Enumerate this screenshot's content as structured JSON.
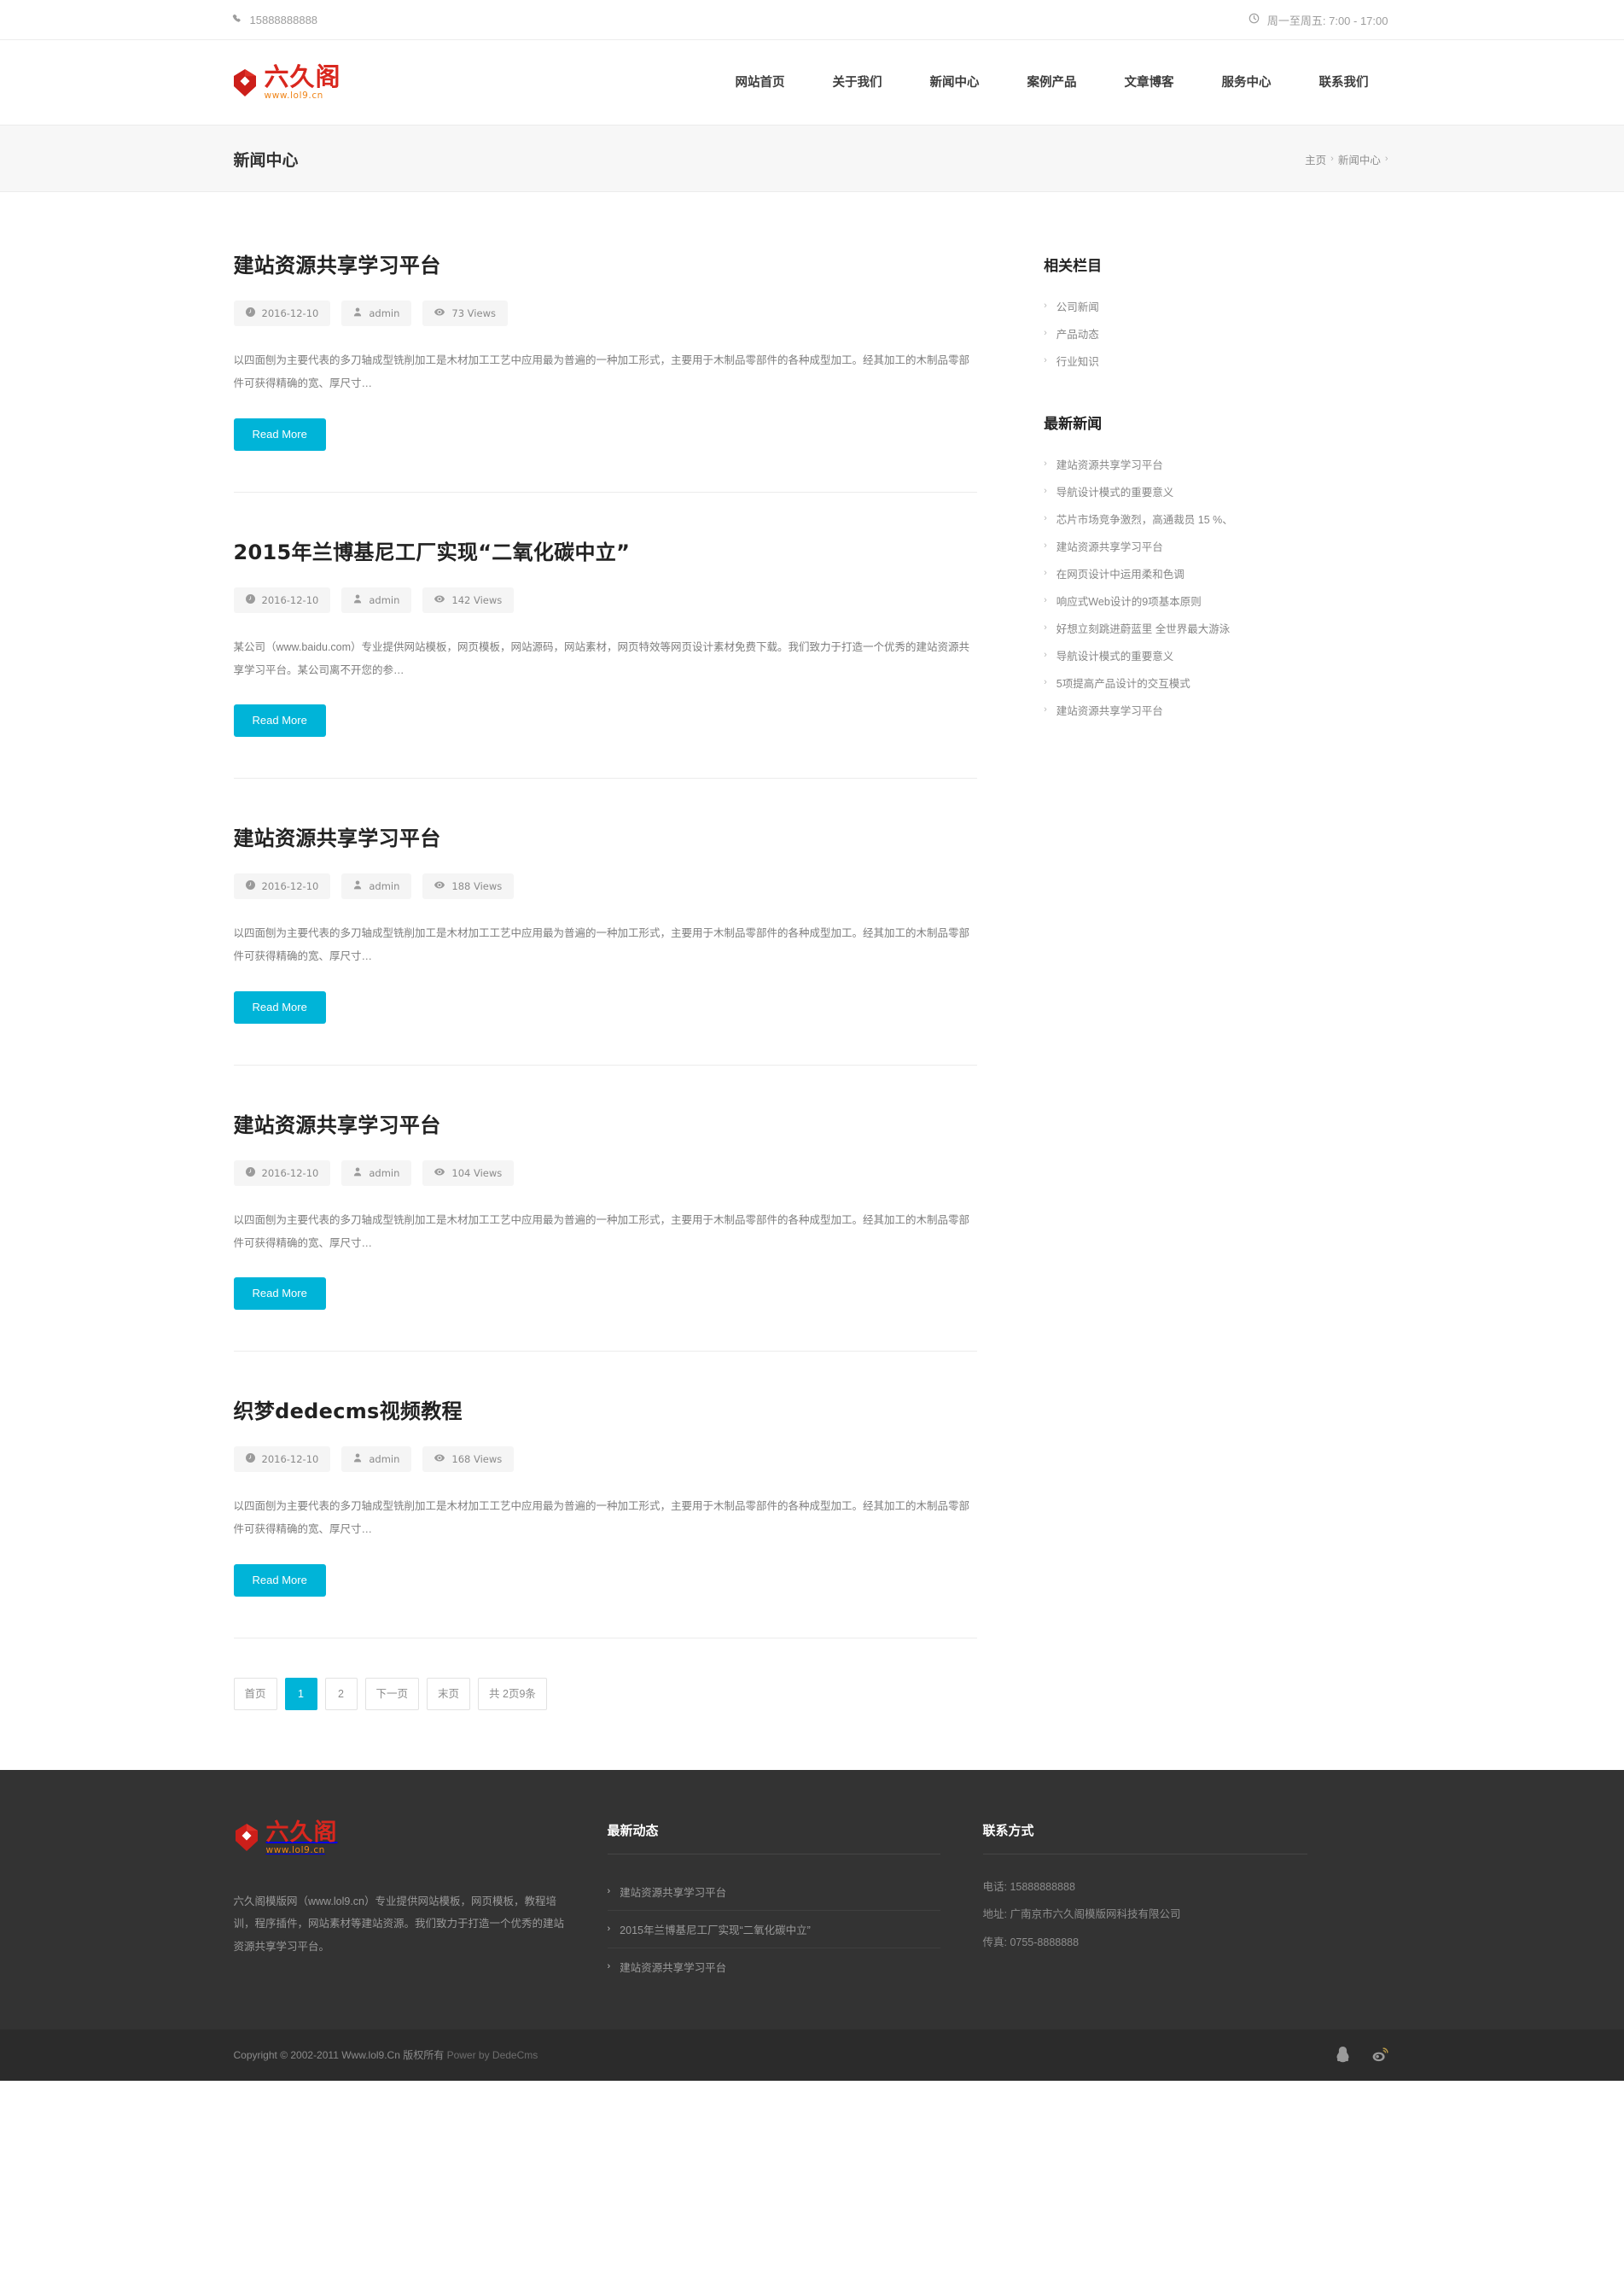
{
  "topbar": {
    "phone": "15888888888",
    "phone_icon": "phone-icon",
    "hours": "周一至周五: 7:00 - 17:00",
    "hours_icon": "clock-icon"
  },
  "brand": {
    "name_cn": "六久阁",
    "url_text": "www.lol9.cn",
    "mark_color": "#cc1f1a",
    "text_color": "#d9271e",
    "url_color": "#f08519"
  },
  "nav": {
    "items": [
      {
        "label": "网站首页",
        "active": false
      },
      {
        "label": "关于我们",
        "active": false
      },
      {
        "label": "新闻中心",
        "active": true
      },
      {
        "label": "案例产品",
        "active": false
      },
      {
        "label": "文章博客",
        "active": false
      },
      {
        "label": "服务中心",
        "active": false
      },
      {
        "label": "联系我们",
        "active": false
      }
    ]
  },
  "banner": {
    "title": "新闻中心",
    "breadcrumb": {
      "home": "主页",
      "current": "新闻中心",
      "separator": "›"
    }
  },
  "articles": [
    {
      "title": "建站资源共享学习平台",
      "date": "2016-12-10",
      "author": "admin",
      "views": "73 Views",
      "excerpt": "以四面刨为主要代表的多刀轴成型铣削加工是木材加工工艺中应用最为普遍的一种加工形式，主要用于木制品零部件的各种成型加工。经其加工的木制品零部件可获得精确的宽、厚尺寸…",
      "button": "Read More"
    },
    {
      "title": "2015年兰博基尼工厂实现“二氧化碳中立”",
      "date": "2016-12-10",
      "author": "admin",
      "views": "142 Views",
      "excerpt": "某公司（www.baidu.com）专业提供网站模板，网页模板，网站源码，网站素材，网页特效等网页设计素材免费下载。我们致力于打造一个优秀的建站资源共享学习平台。某公司离不开您的参…",
      "button": "Read More"
    },
    {
      "title": "建站资源共享学习平台",
      "date": "2016-12-10",
      "author": "admin",
      "views": "188 Views",
      "excerpt": "以四面刨为主要代表的多刀轴成型铣削加工是木材加工工艺中应用最为普遍的一种加工形式，主要用于木制品零部件的各种成型加工。经其加工的木制品零部件可获得精确的宽、厚尺寸…",
      "button": "Read More"
    },
    {
      "title": "建站资源共享学习平台",
      "date": "2016-12-10",
      "author": "admin",
      "views": "104 Views",
      "excerpt": "以四面刨为主要代表的多刀轴成型铣削加工是木材加工工艺中应用最为普遍的一种加工形式，主要用于木制品零部件的各种成型加工。经其加工的木制品零部件可获得精确的宽、厚尺寸…",
      "button": "Read More"
    },
    {
      "title": "织梦dedecms视频教程",
      "date": "2016-12-10",
      "author": "admin",
      "views": "168 Views",
      "excerpt": "以四面刨为主要代表的多刀轴成型铣削加工是木材加工工艺中应用最为普遍的一种加工形式，主要用于木制品零部件的各种成型加工。经其加工的木制品零部件可获得精确的宽、厚尺寸…",
      "button": "Read More"
    }
  ],
  "pagination": {
    "first": "首页",
    "pages": [
      "1",
      "2"
    ],
    "current": "1",
    "next": "下一页",
    "last": "末页",
    "info": "共 2页9条"
  },
  "sidebar": {
    "categories": {
      "title": "相关栏目",
      "items": [
        "公司新闻",
        "产品动态",
        "行业知识"
      ]
    },
    "latest": {
      "title": "最新新闻",
      "items": [
        "建站资源共享学习平台",
        "导航设计模式的重要意义",
        "芯片市场竞争激烈，高通裁员 15 %、",
        "建站资源共享学习平台",
        "在网页设计中运用柔和色调",
        "响应式Web设计的9项基本原则",
        "好想立刻跳进蔚蓝里 全世界最大游泳",
        "导航设计模式的重要意义",
        "5项提高产品设计的交互模式",
        "建站资源共享学习平台"
      ]
    }
  },
  "footer": {
    "about": {
      "description": "六久阁模版网（www.lol9.cn）专业提供网站模板，网页模板，教程培训，程序插件，网站素材等建站资源。我们致力于打造一个优秀的建站资源共享学习平台。"
    },
    "news": {
      "title": "最新动态",
      "items": [
        "建站资源共享学习平台",
        "2015年兰博基尼工厂实现“二氧化碳中立”",
        "建站资源共享学习平台"
      ]
    },
    "contact": {
      "title": "联系方式",
      "lines": [
        "电话: 15888888888",
        "地址: 广南京市六久阁模版网科技有限公司",
        "传真: 0755-8888888"
      ]
    },
    "copyright_main": "Copyright © 2002-2011 Www.lol9.Cn 版权所有",
    "copyright_dim": "Power by DedeCms",
    "socials": [
      "qq-icon",
      "weibo-icon"
    ]
  }
}
